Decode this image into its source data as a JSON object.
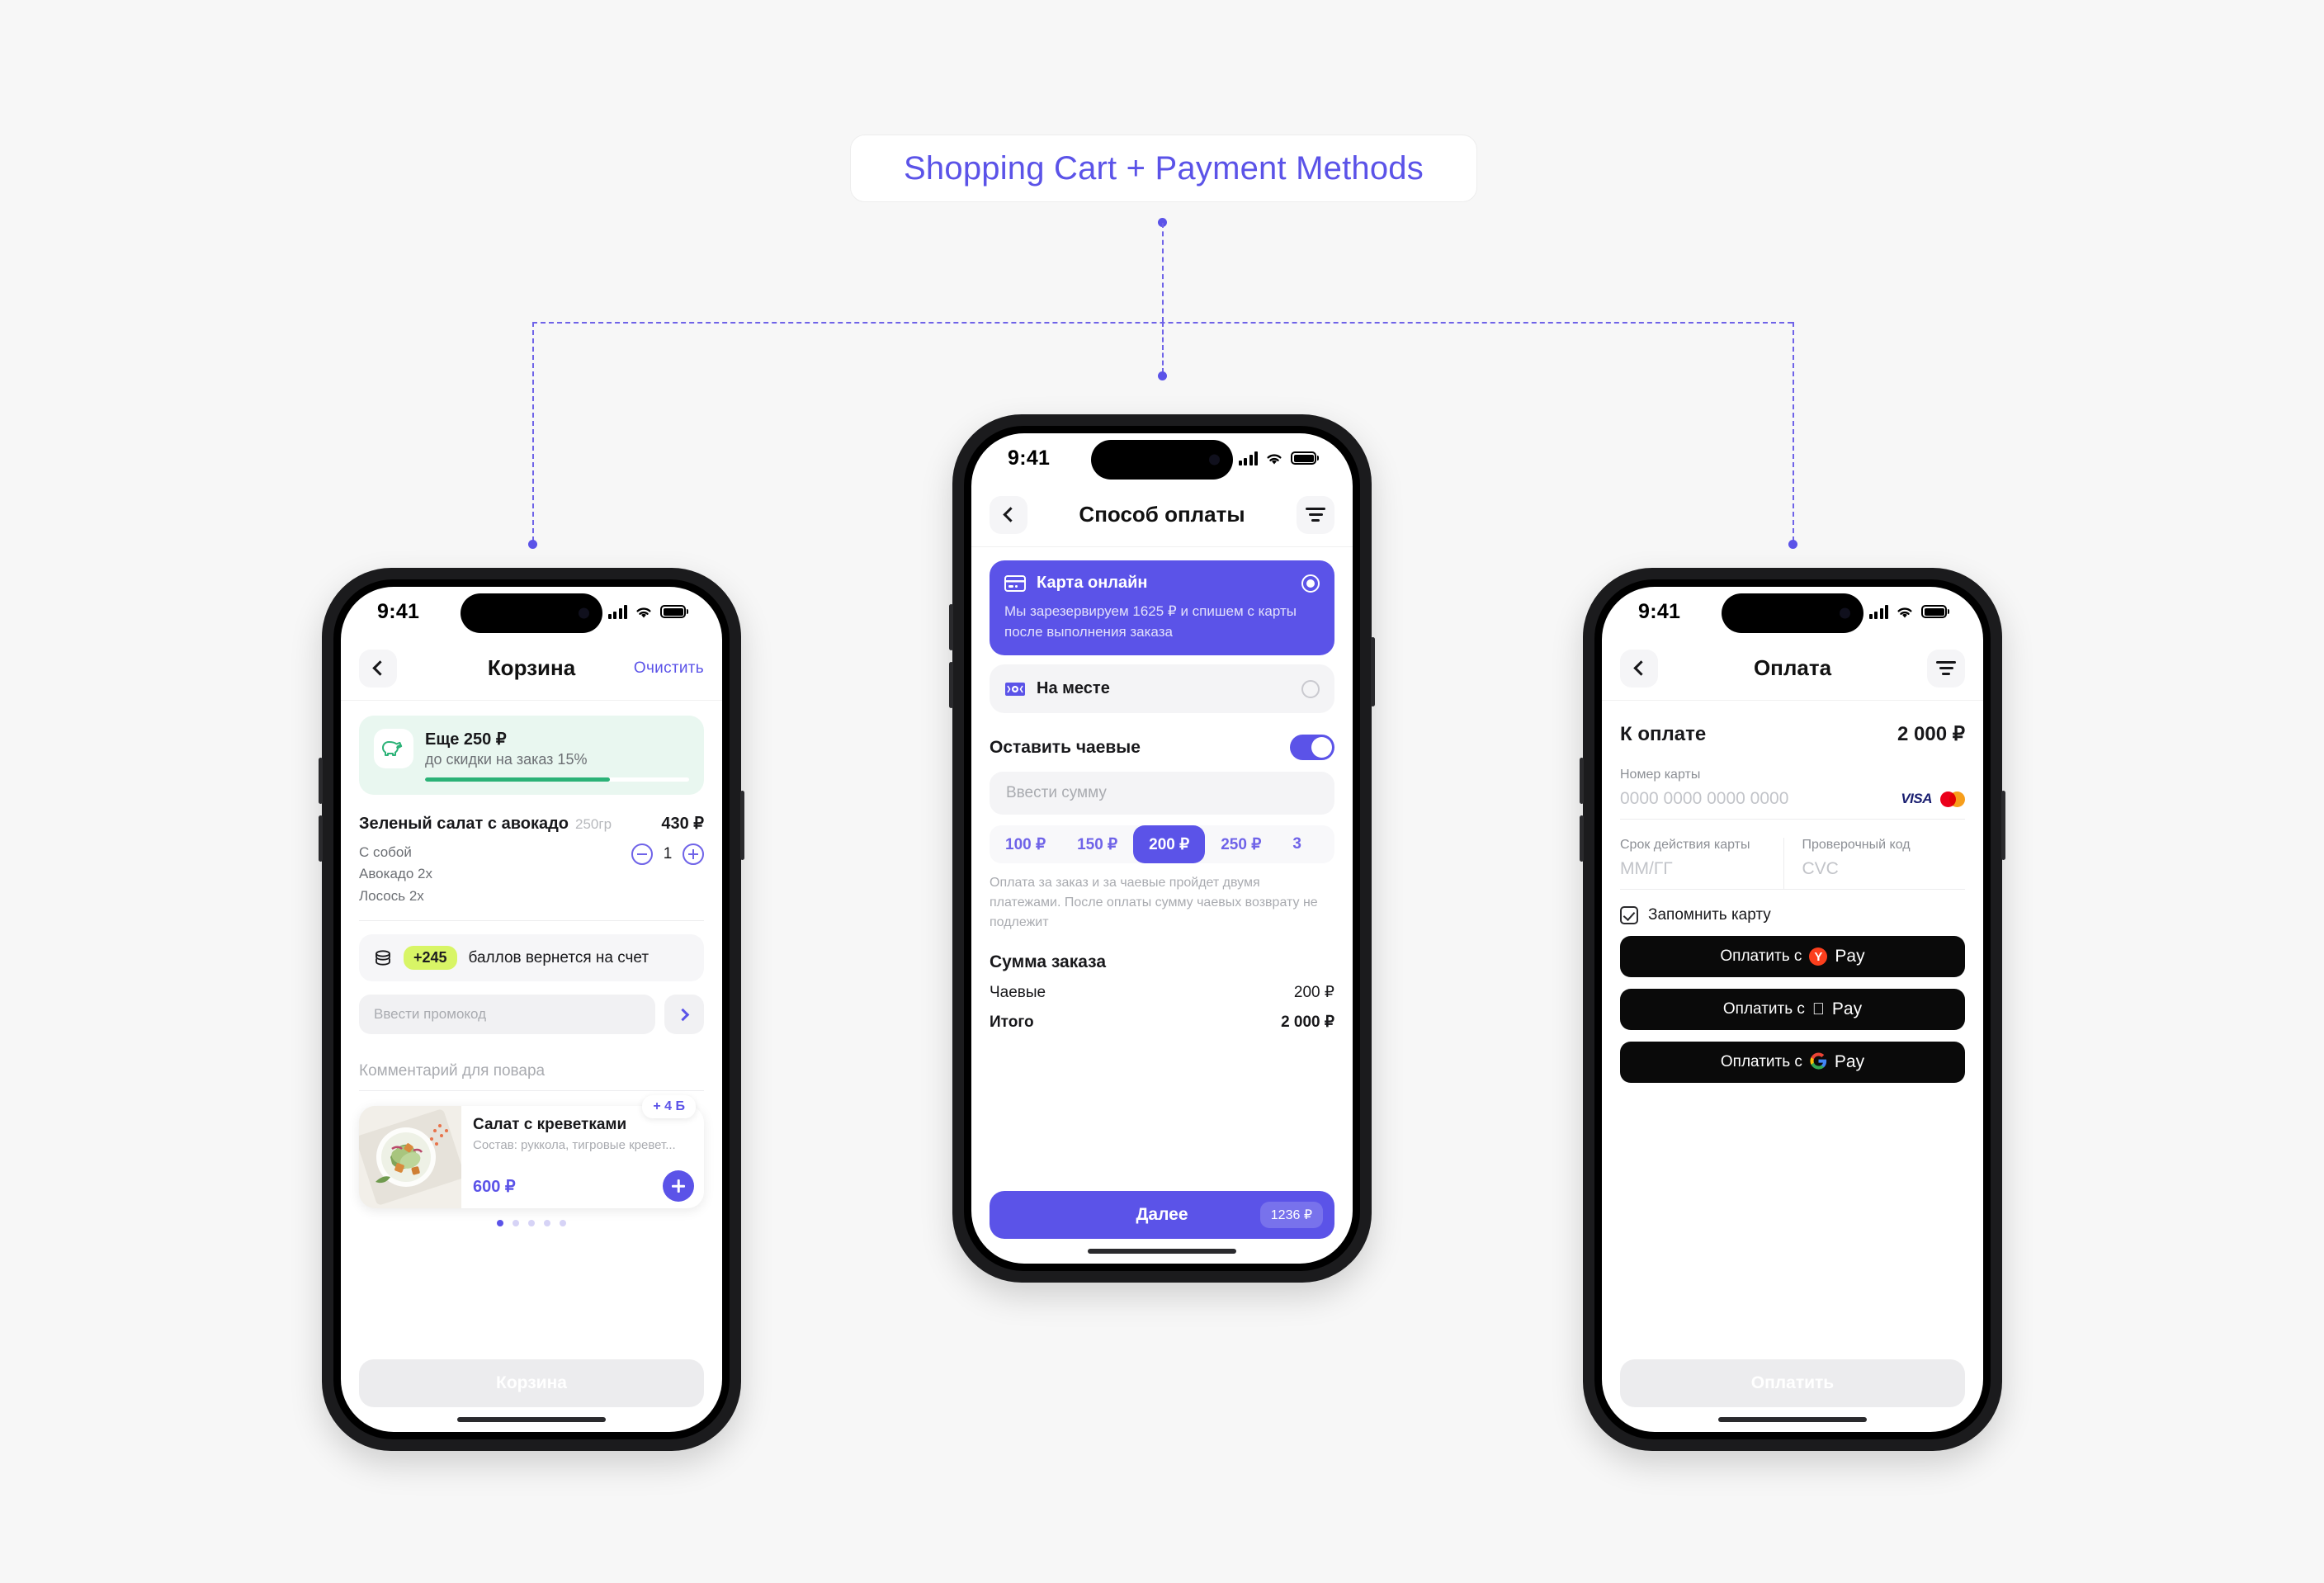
{
  "flow": {
    "title": "Shopping Cart + Payment Methods"
  },
  "statusbar": {
    "time": "9:41",
    "signal_icon": "cellular-bars-icon",
    "wifi_icon": "wifi-icon",
    "battery_icon": "battery-icon"
  },
  "cart_screen": {
    "nav": {
      "back_icon": "chevron-left-icon",
      "title": "Корзина",
      "action": "Очистить"
    },
    "promo_banner": {
      "icon": "piggy-bank-icon",
      "title": "Еще 250 ₽",
      "subtitle": "до скидки на заказ 15%",
      "progress_percent": 70
    },
    "items": [
      {
        "name": "Зеленый салат с авокадо",
        "weight": "250гр",
        "price": "430 ₽",
        "options": [
          "С собой",
          "Авокадо 2x",
          "Лосось 2x"
        ],
        "quantity": "1",
        "minus_icon": "minus-circle-icon",
        "plus_icon": "plus-circle-icon"
      }
    ],
    "points": {
      "icon": "coins-icon",
      "badge": "+245",
      "text": "баллов вернется на счет"
    },
    "promo_code": {
      "placeholder": "Ввести промокод",
      "value": "",
      "submit_icon": "chevron-right-icon"
    },
    "comment": {
      "placeholder": "Комментарий для повара",
      "value": ""
    },
    "suggestion": {
      "badge": "+ 4 Б",
      "image_icon": "salad-photo",
      "title": "Салат с креветками",
      "description": "Состав: руккола, тигровые кревет...",
      "price": "600 ₽",
      "add_icon": "plus-icon"
    },
    "carousel_dots": 5,
    "carousel_active": 0,
    "footer_button": "Корзина"
  },
  "payment_method_screen": {
    "nav": {
      "back_icon": "chevron-left-icon",
      "title": "Способ оплаты",
      "filter_icon": "filter-icon"
    },
    "methods": [
      {
        "icon": "credit-card-icon",
        "label": "Карта онлайн",
        "note": "Мы зарезервируем 1625 ₽ и спишем с карты после выполнения заказа",
        "selected": true
      },
      {
        "icon": "banknote-icon",
        "label": "На месте",
        "note": "",
        "selected": false
      }
    ],
    "tips": {
      "title": "Оставить чаевые",
      "enabled": true,
      "input_placeholder": "Ввести сумму",
      "input_value": "",
      "amounts": [
        "100 ₽",
        "150 ₽",
        "200 ₽",
        "250 ₽",
        "3"
      ],
      "selected_amount": "200 ₽",
      "note": "Оплата за заказ и за чаевые пройдет двумя платежами. После оплаты сумму чаевых возврату не подлежит"
    },
    "summary": {
      "title": "Сумма заказа",
      "rows": [
        {
          "label": "Чаевые",
          "value": "200 ₽",
          "total": false
        },
        {
          "label": "Итого",
          "value": "2 000 ₽",
          "total": true
        }
      ]
    },
    "footer_button": {
      "label": "Далее",
      "amount": "1236 ₽"
    }
  },
  "pay_screen": {
    "nav": {
      "back_icon": "chevron-left-icon",
      "title": "Оплата",
      "filter_icon": "filter-icon"
    },
    "total": {
      "label": "К оплате",
      "value": "2 000 ₽"
    },
    "card_number": {
      "label": "Номер карты",
      "placeholder": "0000 0000 0000 0000",
      "value": "",
      "brands": [
        "VISA",
        "mastercard"
      ]
    },
    "expiry": {
      "label": "Срок действия карты",
      "placeholder": "ММ/ГГ",
      "value": ""
    },
    "cvc": {
      "label": "Проверочный код",
      "placeholder": "CVC",
      "value": ""
    },
    "remember": {
      "label": "Запомнить карту",
      "checked": true
    },
    "wallets": [
      {
        "prefix": "Оплатить с",
        "icon": "yandex-pay-icon",
        "word": "Pay"
      },
      {
        "prefix": "Оплатить с",
        "icon": "apple-pay-icon",
        "word": "Pay"
      },
      {
        "prefix": "Оплатить с",
        "icon": "google-pay-icon",
        "word": "Pay"
      }
    ],
    "footer_button": "Оплатить"
  },
  "colors": {
    "accent": "#5b53e8",
    "background": "#f7f7f7",
    "green": "#2bb277",
    "lime": "#d8f566",
    "dark": "#0a0a0a"
  }
}
